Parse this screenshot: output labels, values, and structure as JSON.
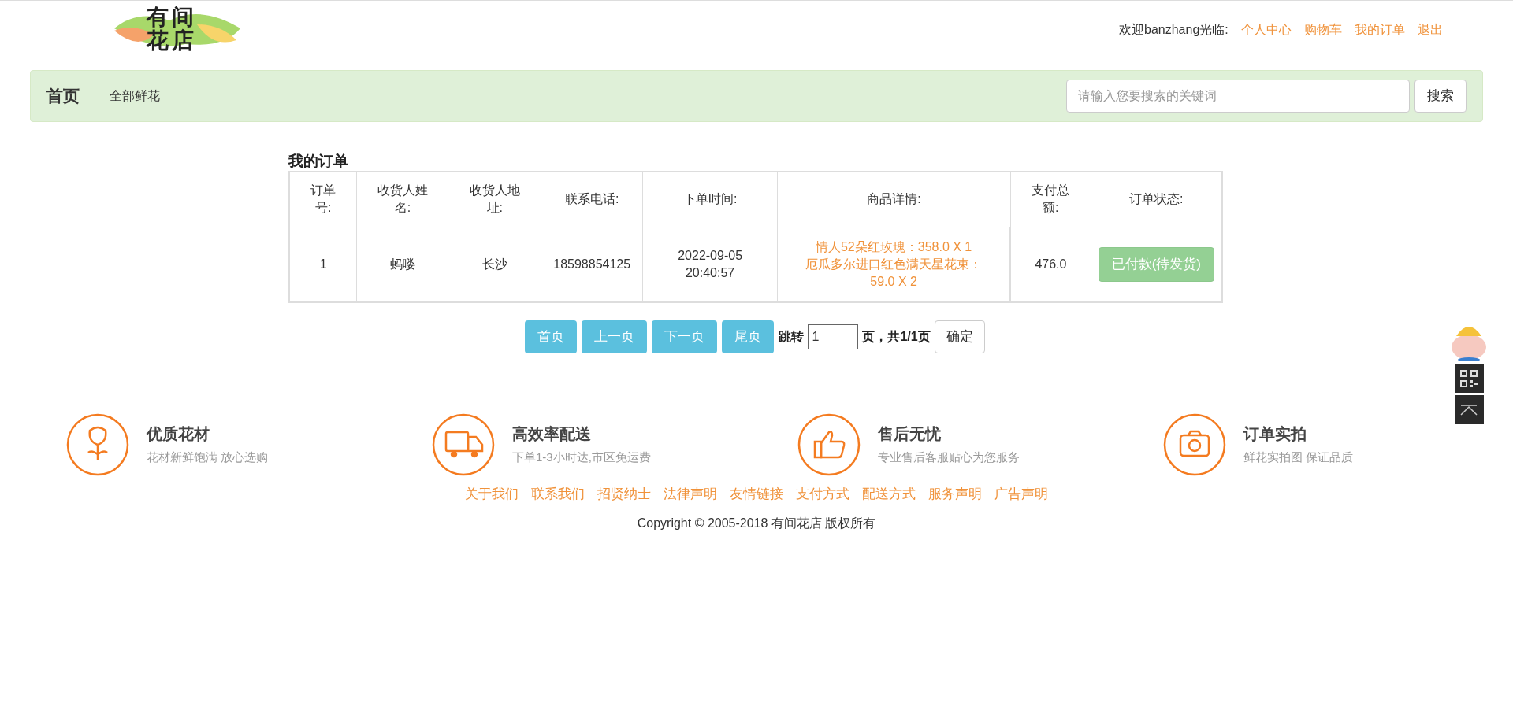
{
  "logo": {
    "text": "有间花店"
  },
  "user_bar": {
    "greeting": "欢迎banzhang光临:",
    "links": [
      "个人中心",
      "购物车",
      "我的订单",
      "退出"
    ]
  },
  "nav": {
    "brand": "首页",
    "items": [
      "全部鲜花"
    ],
    "search": {
      "placeholder": "请输入您要搜索的关键词",
      "button": "搜索"
    }
  },
  "orders": {
    "title": "我的订单",
    "columns": [
      "订单号:",
      "收货人姓名:",
      "收货人地址:",
      "联系电话:",
      "下单时间:",
      "商品详情:",
      "支付总额:",
      "订单状态:"
    ],
    "rows": [
      {
        "id": "1",
        "name": "蚂喽",
        "address": "长沙",
        "phone": "18598854125",
        "time": "2022-09-05 20:40:57",
        "items": [
          "情人52朵红玫瑰：358.0 X 1",
          "厄瓜多尔进口红色满天星花束：59.0 X 2"
        ],
        "total": "476.0",
        "status": "已付款(待发货)"
      }
    ]
  },
  "pagination": {
    "buttons": [
      "首页",
      "上一页",
      "下一页",
      "尾页"
    ],
    "jump_label": "跳转",
    "page_value": "1",
    "page_info": "页，共1/1页",
    "confirm": "确定"
  },
  "features": [
    {
      "kind": "flower",
      "title": "优质花材",
      "subtitle": "花材新鲜饱满 放心选购"
    },
    {
      "kind": "truck",
      "title": "高效率配送",
      "subtitle": "下单1-3小时达,市区免运费"
    },
    {
      "kind": "thumb",
      "title": "售后无忧",
      "subtitle": "专业售后客服贴心为您服务"
    },
    {
      "kind": "camera",
      "title": "订单实拍",
      "subtitle": "鲜花实拍图 保证品质"
    }
  ],
  "footer_links": [
    "关于我们",
    "联系我们",
    "招贤纳士",
    "法律声明",
    "友情链接",
    "支付方式",
    "配送方式",
    "服务声明",
    "广告声明"
  ],
  "copyright": "Copyright © 2005-2018 有间花店 版权所有"
}
